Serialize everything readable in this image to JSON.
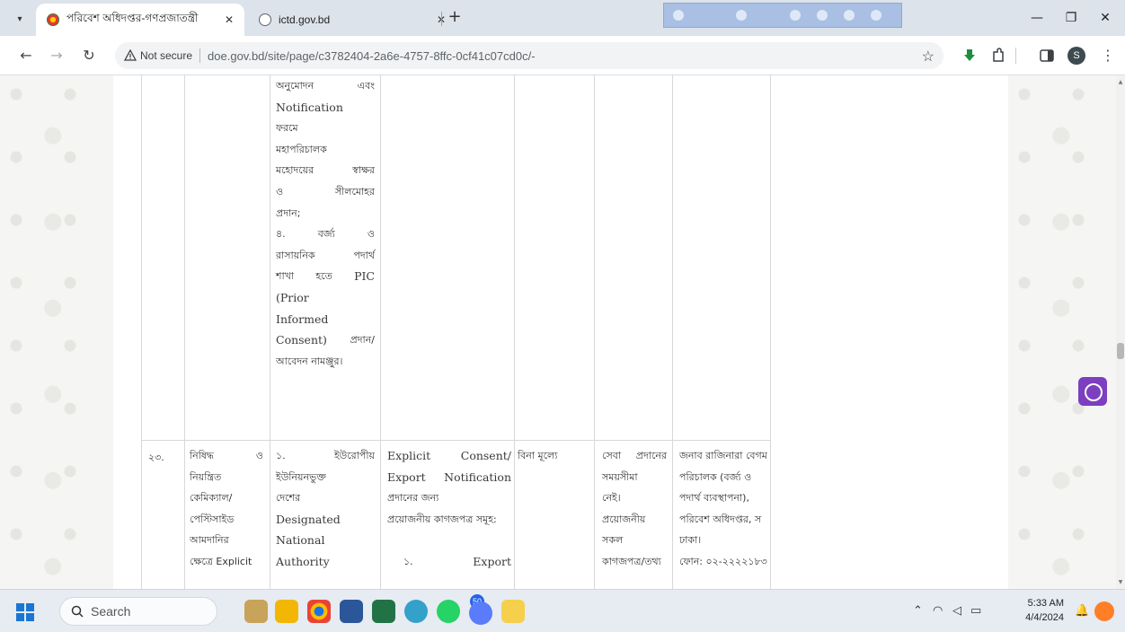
{
  "browser": {
    "tabs": [
      {
        "title": "পরিবেশ অধিদপ্তর-গণপ্রজাতন্ত্রী",
        "active": true
      },
      {
        "title": "ictd.gov.bd",
        "active": false
      }
    ],
    "address": {
      "security_label": "Not secure",
      "url": "doe.gov.bd/site/page/c3782404-2a6e-4757-8ffc-0cf41c07cd0c/-"
    },
    "profile_initial": "S"
  },
  "table": {
    "prev_row": {
      "service_docs_lines": [
        [
          "অনুমোদন",
          "এবং"
        ],
        [
          "Notification"
        ],
        [
          "ফরমে"
        ],
        [
          "মহাপরিচালক"
        ],
        [
          "মহোদয়ের",
          "স্বাক্ষর"
        ],
        [
          "ও",
          "সীলমোহর"
        ],
        [
          "প্রদান;"
        ],
        [
          "৪.",
          "বর্জ্য",
          "ও"
        ],
        [
          "রাসায়নিক",
          "পদার্থ"
        ],
        [
          "শাখা",
          "হতে",
          "PIC"
        ],
        [
          "(Prior"
        ],
        [
          "Informed"
        ],
        [
          "Consent)",
          "প্রদান/"
        ],
        [
          "আবেদন নামঞ্জুর।"
        ]
      ]
    },
    "row": {
      "serial": "২৩.",
      "service_name_lines": [
        [
          "নিষিদ্ধ",
          "ও"
        ],
        [
          "নিয়ন্ত্রিত"
        ],
        [
          "কেমিক্যাল/"
        ],
        [
          "পেস্টিসাইড"
        ],
        [
          "আমদানির"
        ],
        [
          "ক্ষেত্রে Explicit"
        ]
      ],
      "procedure_lines": [
        [
          "১.",
          "ইউরোপীয়"
        ],
        [
          "ইউনিয়নভুক্ত"
        ],
        [
          "দেশের"
        ],
        [
          "Designated"
        ],
        [
          "National"
        ],
        [
          "Authority"
        ]
      ],
      "documents_lines": [
        [
          "Explicit",
          "Consent/"
        ],
        [
          "Export",
          "Notification"
        ],
        [
          "প্রদানের জন্য"
        ],
        [
          "প্রয়োজনীয় কাগজপত্র সমূহ:"
        ],
        [
          ""
        ],
        [
          "১.",
          "Export"
        ]
      ],
      "fee": "বিনা মূল্যে",
      "time_lines": [
        [
          "সেবা",
          "প্রদানের"
        ],
        [
          "সময়সীমা"
        ],
        [
          "নেই।"
        ],
        [
          "প্রয়োজনীয়"
        ],
        [
          "সকল"
        ],
        [
          "কাগজপত্র/তথ্য"
        ]
      ],
      "officer_lines": [
        [
          "জনাব রাজিনারা বেগম"
        ],
        [
          "পরিচালক (বর্জ্য ও"
        ],
        [
          "পদার্থ ব্যবস্থাপনা),"
        ],
        [
          "পরিবেশ অধিদপ্তর, স"
        ],
        [
          "ঢাকা।"
        ],
        [
          "ফোন: ০২-২২২২১৮৩"
        ]
      ]
    }
  },
  "taskbar": {
    "search_placeholder": "Search",
    "notification_count": "50",
    "time": "5:33 AM",
    "date": "4/4/2024"
  }
}
